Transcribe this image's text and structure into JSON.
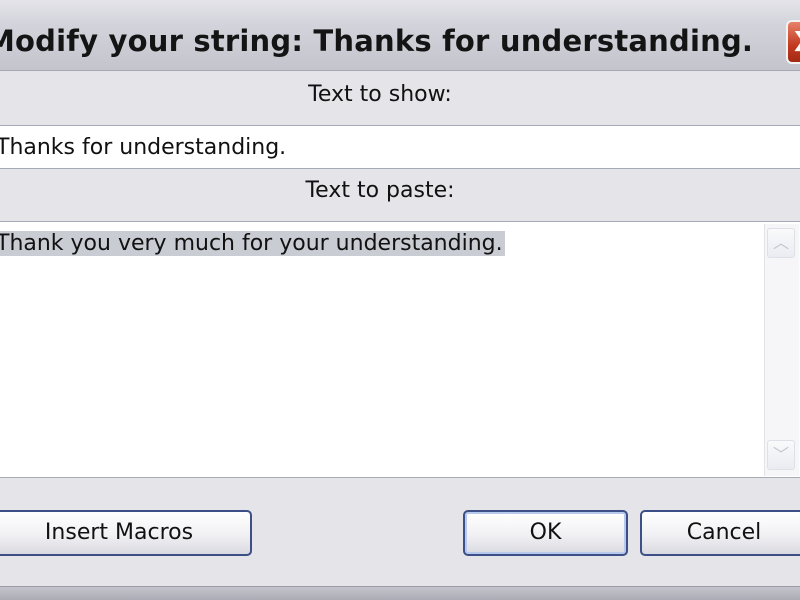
{
  "window": {
    "title": "Modify your string: Thanks for understanding.",
    "close_label": "X"
  },
  "fields": {
    "show_label": "Text to show:",
    "show_value": "Thanks for understanding.",
    "paste_label": "Text to paste:",
    "paste_value": "Thank you very much for your understanding."
  },
  "scrollbar": {
    "up_arrow": "︿",
    "down_arrow": "﹀"
  },
  "buttons": {
    "insert_macros": "Insert Macros",
    "ok": "OK",
    "cancel": "Cancel"
  },
  "colors": {
    "selection_highlight": "#c9ccd3",
    "button_border": "#3c4f86",
    "close_button": "#c0391f"
  }
}
